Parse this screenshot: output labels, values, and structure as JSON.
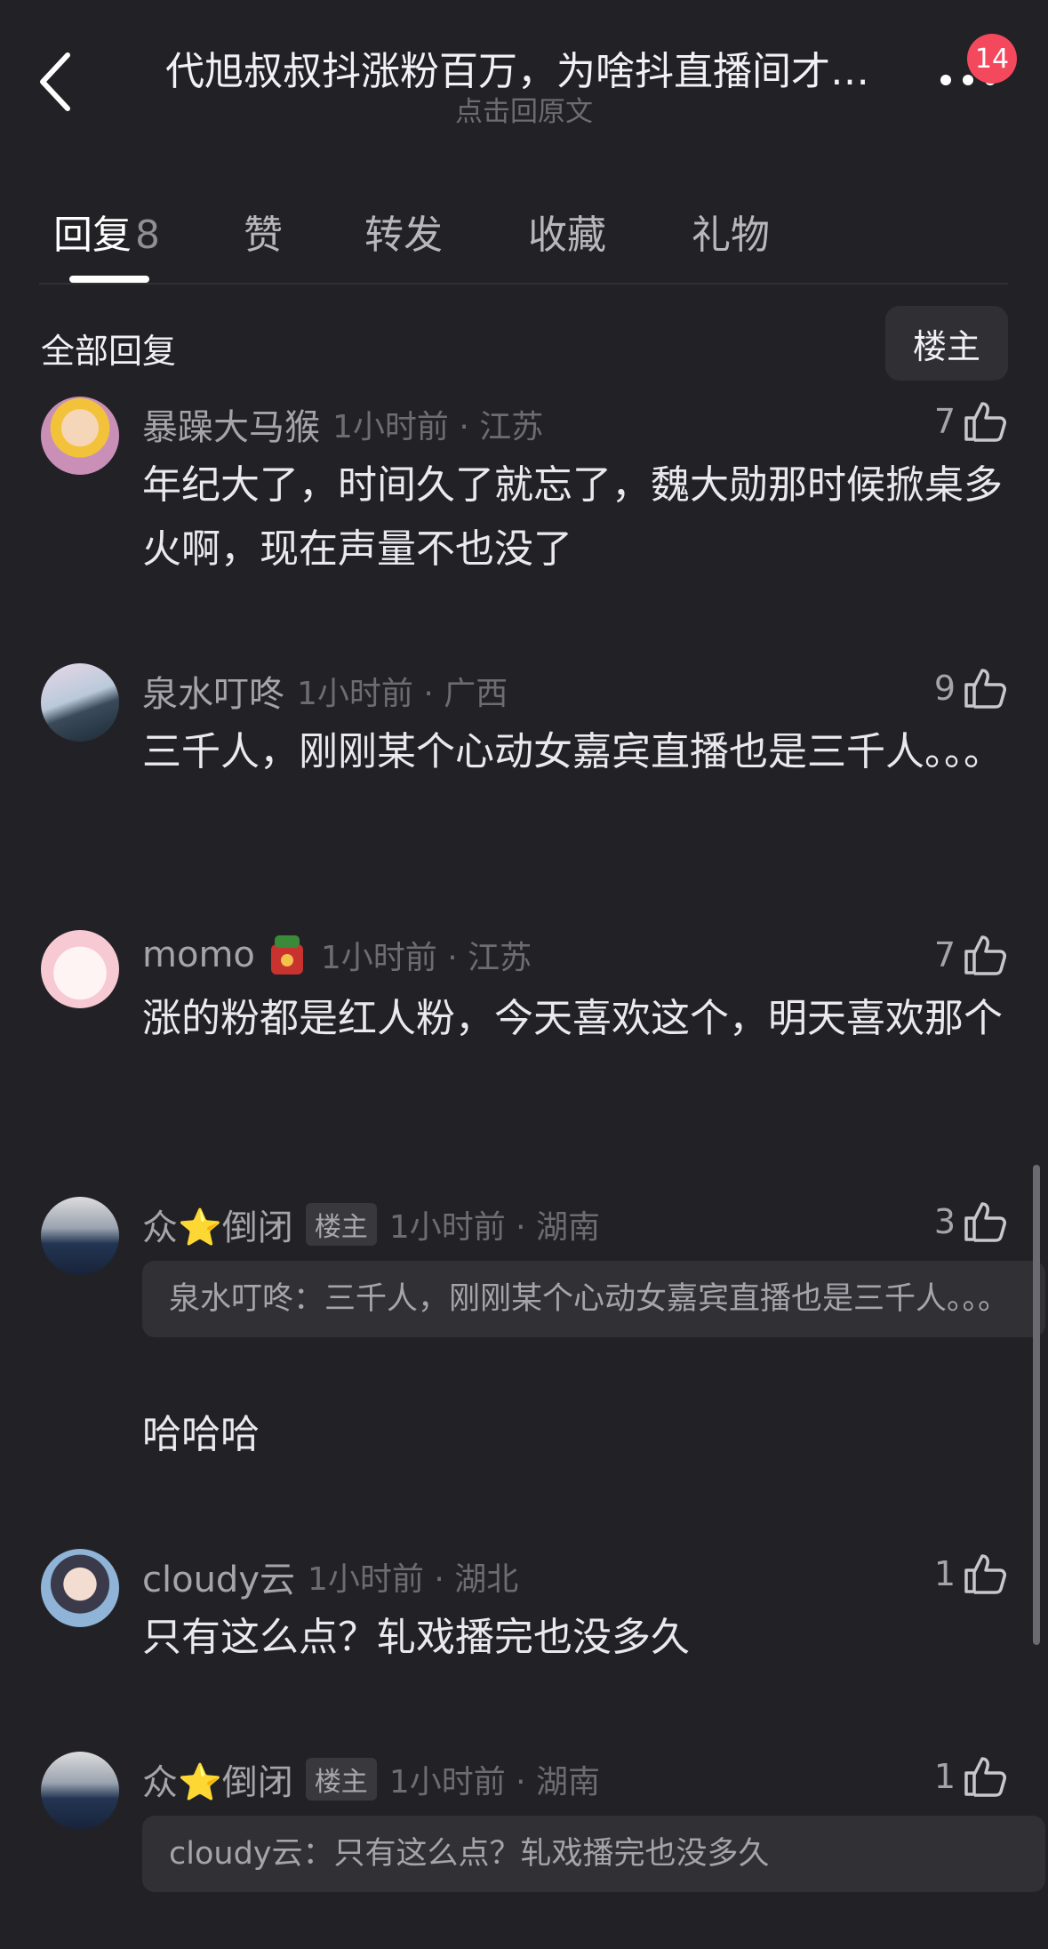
{
  "header": {
    "title": "代旭叔叔抖涨粉百万，为啥抖直播间才…",
    "subtitle": "点击回原文",
    "badge": "14"
  },
  "tabs": [
    {
      "label": "回复",
      "count": "8"
    },
    {
      "label": "赞"
    },
    {
      "label": "转发"
    },
    {
      "label": "收藏"
    },
    {
      "label": "礼物"
    }
  ],
  "section": {
    "all_replies": "全部回复",
    "owner_filter": "楼主"
  },
  "comments": [
    {
      "user": "暴躁大马猴",
      "time": "1小时前 · 江苏",
      "likes": "7",
      "text": "年纪大了，时间久了就忘了，魏大勋那时候掀桌多火啊，现在声量不也没了"
    },
    {
      "user": "泉水叮咚",
      "time": "1小时前 · 广西",
      "likes": "9",
      "text": "三千人，刚刚某个心动女嘉宾直播也是三千人。。。"
    },
    {
      "user": "momo",
      "time": "1小时前 · 江苏",
      "likes": "7",
      "text": "涨的粉都是红人粉，今天喜欢这个，明天喜欢那个"
    },
    {
      "user": "众⭐倒闭",
      "tag": "楼主",
      "time": "1小时前 · 湖南",
      "likes": "3",
      "quote": "泉水叮咚：三千人，刚刚某个心动女嘉宾直播也是三千人。。。",
      "text": "哈哈哈"
    },
    {
      "user": "cloudy云",
      "time": "1小时前 · 湖北",
      "likes": "1",
      "text": "只有这么点？轧戏播完也没多久"
    },
    {
      "user": "众⭐倒闭",
      "tag": "楼主",
      "time": "1小时前 · 湖南",
      "likes": "1",
      "quote": "cloudy云：只有这么点？轧戏播完也没多久"
    }
  ],
  "icons": {
    "back": "chevron-left-icon",
    "more": "more-dots-icon",
    "like": "thumbs-up-icon"
  },
  "colors": {
    "background": "#222226",
    "badge": "#f4485d"
  }
}
